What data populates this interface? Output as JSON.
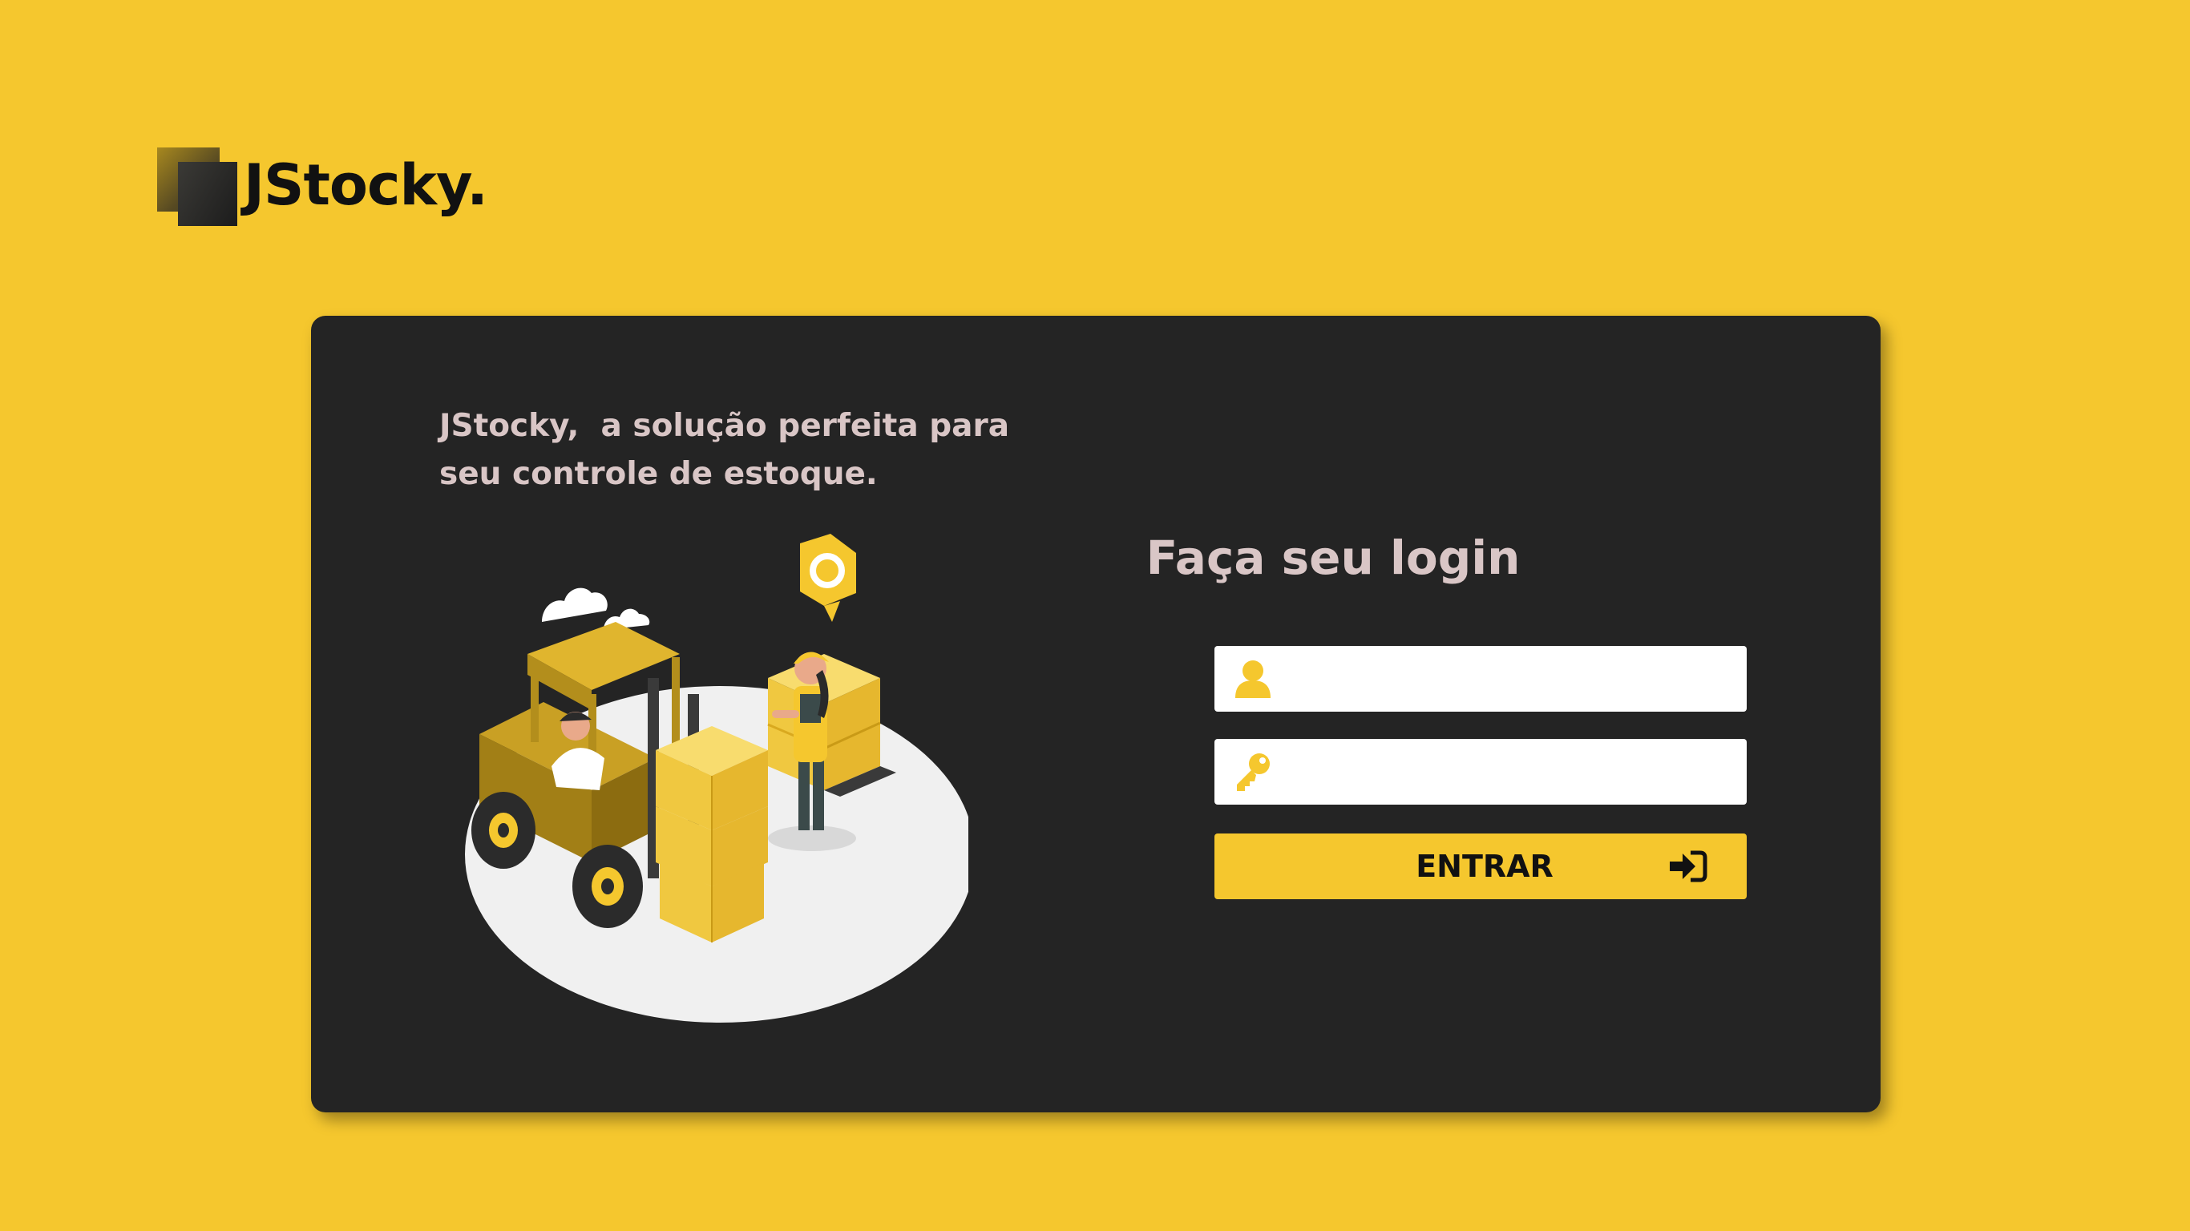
{
  "brand": {
    "name": "JStocky."
  },
  "card": {
    "tagline_line1": "JStocky,  a solução perfeita para",
    "tagline_line2": "seu controle de estoque."
  },
  "login": {
    "title": "Faça seu login",
    "username": {
      "value": "",
      "placeholder": ""
    },
    "password": {
      "value": "",
      "placeholder": ""
    },
    "submit_label": "ENTRAR"
  },
  "icons": {
    "username": "user-icon",
    "password": "key-icon",
    "submit": "sign-in-icon"
  },
  "colors": {
    "background": "#F5C72E",
    "card": "#242424",
    "heading_text": "#D9C6C6",
    "accent": "#F5C72E"
  }
}
